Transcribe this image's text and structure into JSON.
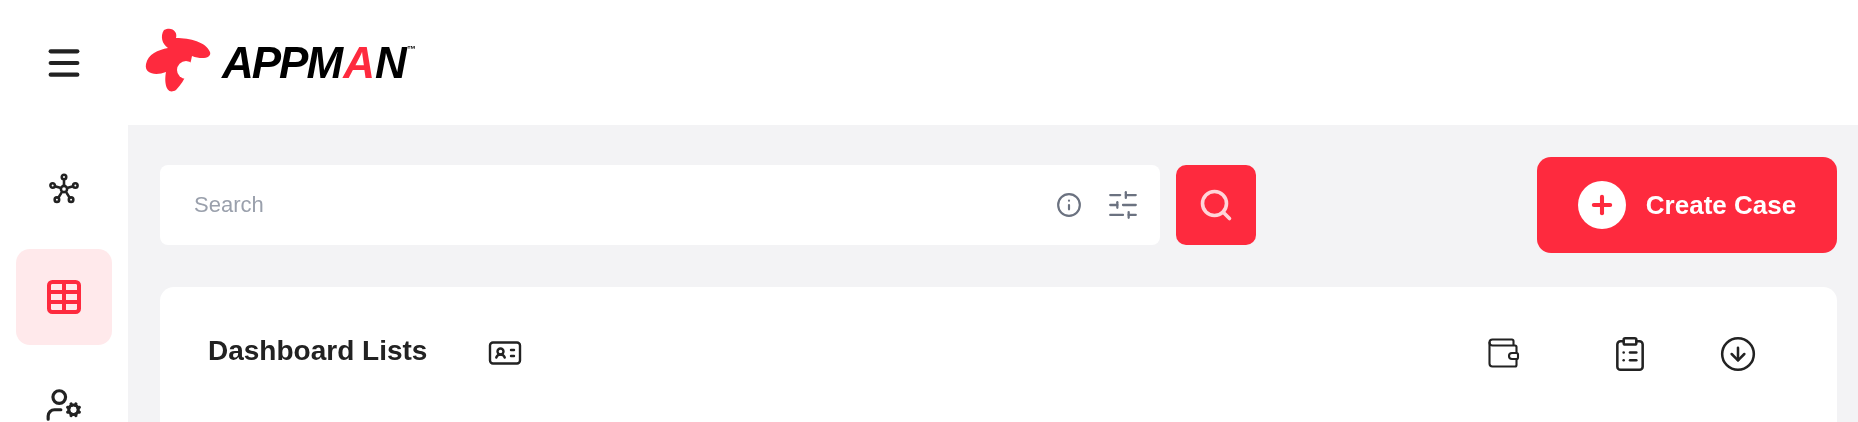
{
  "logo": {
    "parts": [
      {
        "text": "APPM",
        "accent": false
      },
      {
        "text": "A",
        "accent": true
      },
      {
        "text": "N",
        "accent": false
      }
    ],
    "mark": "™"
  },
  "sidebar": {
    "items": [
      {
        "kind": "network",
        "selected": false
      },
      {
        "kind": "table",
        "selected": true
      },
      {
        "kind": "user-settings",
        "selected": false
      }
    ]
  },
  "search": {
    "placeholder": "Search"
  },
  "create_button": {
    "label": "Create Case"
  },
  "card": {
    "title": "Dashboard Lists"
  }
}
